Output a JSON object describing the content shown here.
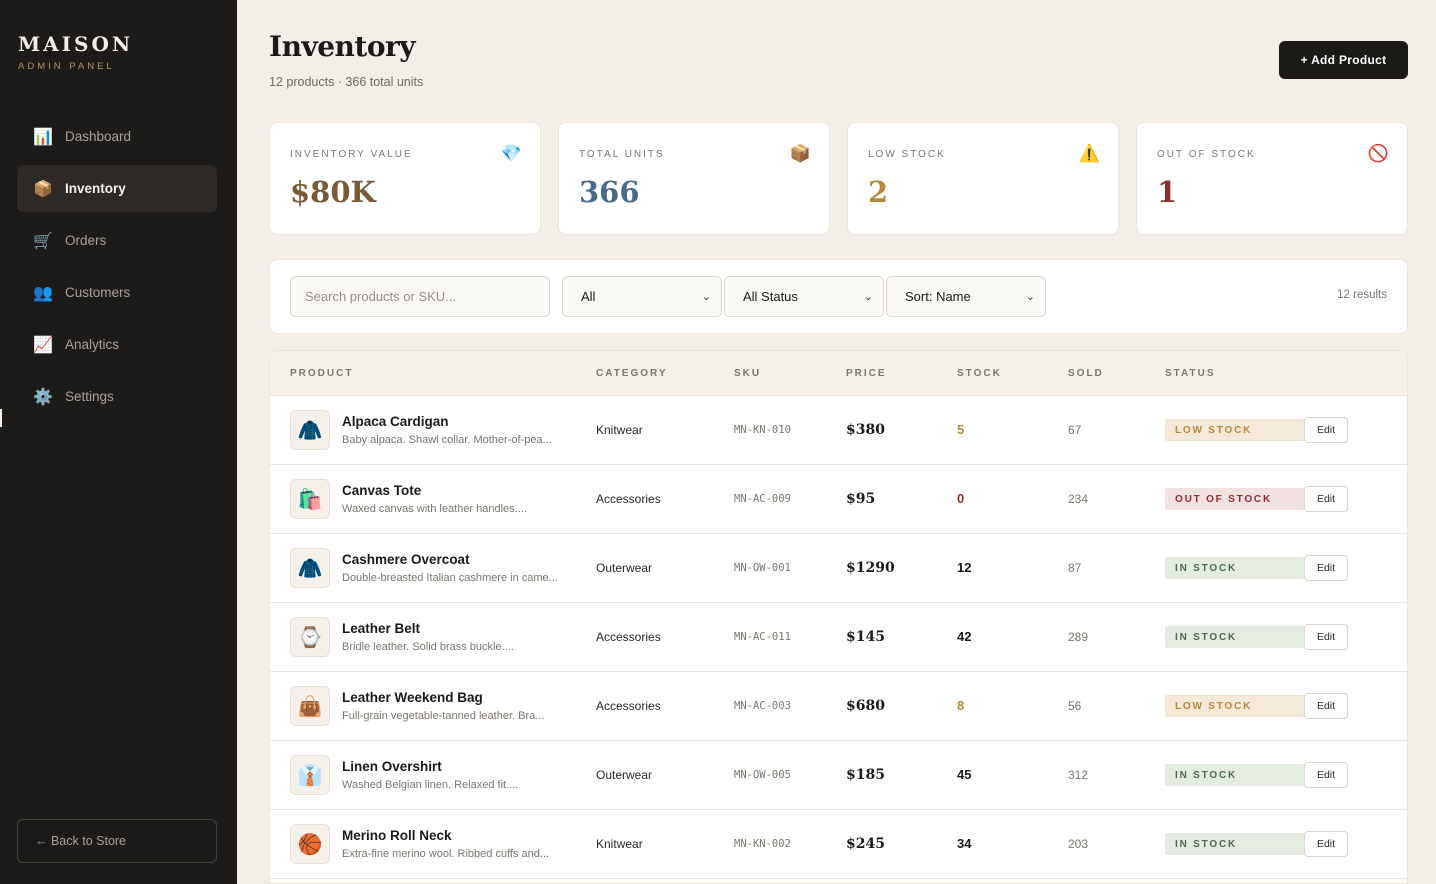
{
  "brand": {
    "name": "MAISON",
    "subtitle": "ADMIN PANEL"
  },
  "nav": [
    {
      "label": "Dashboard",
      "icon": "📊",
      "icon_name": "chart-icon",
      "active": false
    },
    {
      "label": "Inventory",
      "icon": "📦",
      "icon_name": "box-icon",
      "active": true
    },
    {
      "label": "Orders",
      "icon": "🛒",
      "icon_name": "cart-icon",
      "active": false
    },
    {
      "label": "Customers",
      "icon": "👥",
      "icon_name": "users-icon",
      "active": false
    },
    {
      "label": "Analytics",
      "icon": "📈",
      "icon_name": "trend-icon",
      "active": false
    },
    {
      "label": "Settings",
      "icon": "⚙️",
      "icon_name": "gear-icon",
      "active": false
    }
  ],
  "back_to_store": "← Back to Store",
  "header": {
    "title": "Inventory",
    "subtitle": "12 products · 366 total units",
    "add_button": "+ Add Product"
  },
  "stats": [
    {
      "label": "INVENTORY VALUE",
      "value": "$80K",
      "icon": "💎",
      "icon_name": "gem-icon",
      "color": "#7a5a35"
    },
    {
      "label": "TOTAL UNITS",
      "value": "366",
      "icon": "📦",
      "icon_name": "box-icon",
      "color": "#4a6a8a"
    },
    {
      "label": "LOW STOCK",
      "value": "2",
      "icon": "⚠️",
      "icon_name": "warning-icon",
      "color": "#b5883b"
    },
    {
      "label": "OUT OF STOCK",
      "value": "1",
      "icon": "🚫",
      "icon_name": "prohibited-icon",
      "color": "#8e2c2c"
    }
  ],
  "filters": {
    "search_placeholder": "Search products or SKU...",
    "category": "All",
    "status": "All Status",
    "sort": "Sort: Name",
    "results": "12 results"
  },
  "table": {
    "columns": [
      "PRODUCT",
      "CATEGORY",
      "SKU",
      "PRICE",
      "STOCK",
      "SOLD",
      "STATUS"
    ],
    "edit_label": "Edit",
    "rows": [
      {
        "icon": "🧥",
        "icon_name": "coat-icon",
        "name": "Alpaca Cardigan",
        "desc": "Baby alpaca. Shawl collar. Mother-of-pea...",
        "category": "Knitwear",
        "sku": "MN-KN-010",
        "price": "$380",
        "stock": "5",
        "sold": "67",
        "status": "LOW STOCK",
        "status_key": "low"
      },
      {
        "icon": "🛍️",
        "icon_name": "shopping-bags-icon",
        "name": "Canvas Tote",
        "desc": "Waxed canvas with leather handles....",
        "category": "Accessories",
        "sku": "MN-AC-009",
        "price": "$95",
        "stock": "0",
        "sold": "234",
        "status": "OUT OF STOCK",
        "status_key": "out"
      },
      {
        "icon": "🧥",
        "icon_name": "coat-icon",
        "name": "Cashmere Overcoat",
        "desc": "Double-breasted Italian cashmere in came...",
        "category": "Outerwear",
        "sku": "MN-OW-001",
        "price": "$1290",
        "stock": "12",
        "sold": "87",
        "status": "IN STOCK",
        "status_key": "in"
      },
      {
        "icon": "⌚",
        "icon_name": "watch-icon",
        "name": "Leather Belt",
        "desc": "Bridle leather. Solid brass buckle....",
        "category": "Accessories",
        "sku": "MN-AC-011",
        "price": "$145",
        "stock": "42",
        "sold": "289",
        "status": "IN STOCK",
        "status_key": "in"
      },
      {
        "icon": "👜",
        "icon_name": "handbag-icon",
        "name": "Leather Weekend Bag",
        "desc": "Full-grain vegetable-tanned leather. Bra...",
        "category": "Accessories",
        "sku": "MN-AC-003",
        "price": "$680",
        "stock": "8",
        "sold": "56",
        "status": "LOW STOCK",
        "status_key": "low"
      },
      {
        "icon": "👔",
        "icon_name": "shirt-icon",
        "name": "Linen Overshirt",
        "desc": "Washed Belgian linen. Relaxed fit....",
        "category": "Outerwear",
        "sku": "MN-OW-005",
        "price": "$185",
        "stock": "45",
        "sold": "312",
        "status": "IN STOCK",
        "status_key": "in"
      },
      {
        "icon": "🏀",
        "icon_name": "yarn-ball-icon",
        "name": "Merino Roll Neck",
        "desc": "Extra-fine merino wool. Ribbed cuffs and...",
        "category": "Knitwear",
        "sku": "MN-KN-002",
        "price": "$245",
        "stock": "34",
        "sold": "203",
        "status": "IN STOCK",
        "status_key": "in"
      }
    ]
  },
  "status_styles": {
    "low": {
      "bg": "#f3e9d8",
      "fg": "#b5883b",
      "stock_color": "#b5883b"
    },
    "out": {
      "bg": "#f1e1e1",
      "fg": "#8e2c2c",
      "stock_color": "#8e2c2c"
    },
    "in": {
      "bg": "#e4ece2",
      "fg": "#4b6b48",
      "stock_color": "#1c1a17"
    }
  }
}
